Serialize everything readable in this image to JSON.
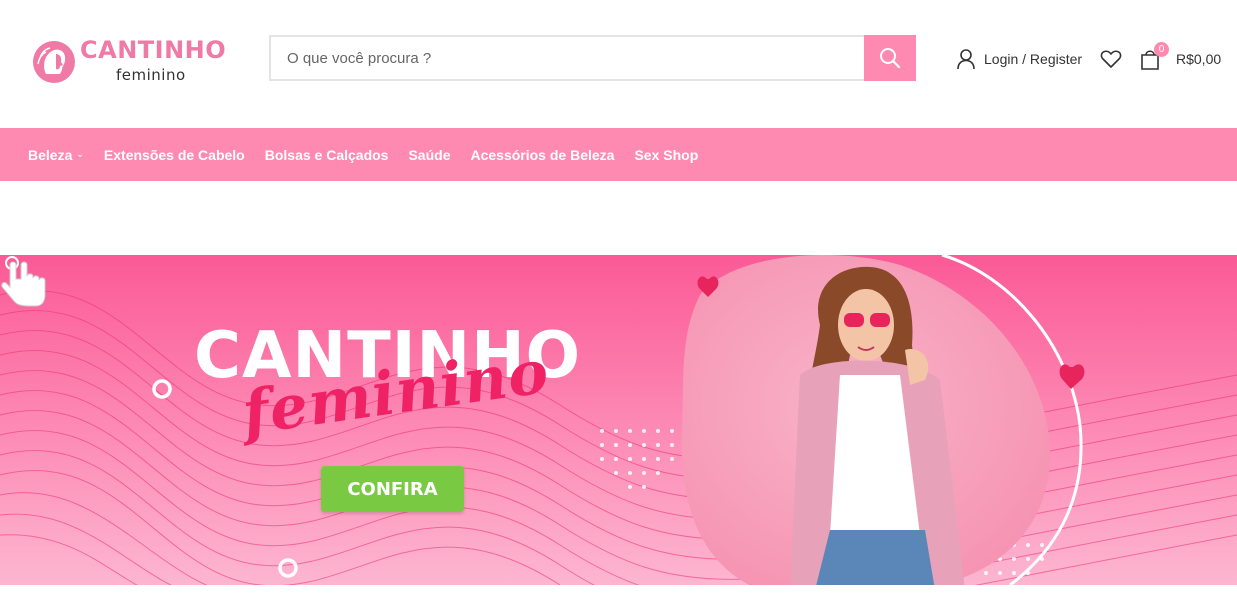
{
  "brand": {
    "name": "CANTINHO",
    "tagline": "feminino",
    "color": "#f07aa6"
  },
  "search": {
    "placeholder": "O que você procura ?"
  },
  "account": {
    "login_label": "Login / Register"
  },
  "cart": {
    "count": "0",
    "total": "R$0,00"
  },
  "nav": {
    "items": [
      {
        "label": "Beleza",
        "has_dropdown": true
      },
      {
        "label": "Extensões de Cabelo"
      },
      {
        "label": "Bolsas e Calçados"
      },
      {
        "label": "Saúde"
      },
      {
        "label": "Acessórios de Beleza"
      },
      {
        "label": "Sex Shop"
      }
    ]
  },
  "banner": {
    "title": "CANTINHO",
    "script": "feminino",
    "cta_label": "CONFIRA"
  },
  "colors": {
    "accent": "#ff8ab1",
    "banner_pink": "#fb5a96",
    "cta_green": "#7ac943",
    "script_red": "#ee2265"
  }
}
